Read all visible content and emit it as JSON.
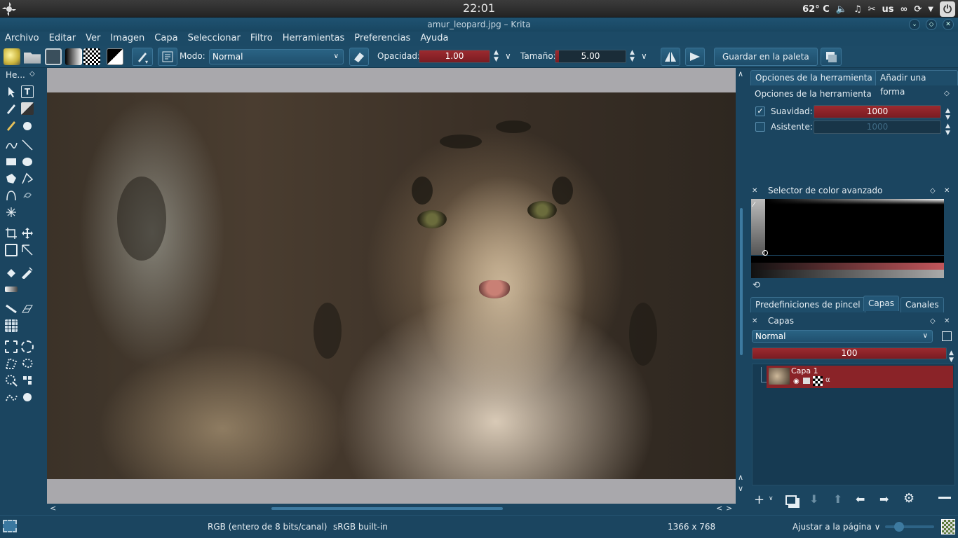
{
  "system": {
    "clock": "22:01",
    "temperature": "62° C",
    "keyboard_layout": "us",
    "icons": [
      "volume-icon",
      "music-icon",
      "scissors-icon",
      "keyboard-icon",
      "link-icon",
      "network-icon",
      "chevron-down-icon",
      "power-icon"
    ]
  },
  "window": {
    "title": "amur_leopard.jpg – Krita"
  },
  "menu": [
    "Archivo",
    "Editar",
    "Ver",
    "Imagen",
    "Capa",
    "Seleccionar",
    "Filtro",
    "Herramientas",
    "Preferencias",
    "Ayuda"
  ],
  "toolbar": {
    "mode_label": "Modo:",
    "mode_value": "Normal",
    "opacity_label": "Opacidad:",
    "opacity_value": "1.00",
    "opacity_fraction": 1.0,
    "size_label": "Tamaño:",
    "size_value": "5.00",
    "size_fraction": 0.05,
    "save_palette_label": "Guardar en la paleta"
  },
  "toolbox": {
    "title": "He..."
  },
  "tool_options": {
    "tab_options": "Opciones de la herramienta",
    "tab_add_shape": "Añadir una forma",
    "panel_title": "Opciones de la herramienta",
    "smoothing_label": "Suavidad:",
    "smoothing_value": "1000",
    "smoothing_checked": true,
    "assistant_label": "Asistente:",
    "assistant_value": "1000",
    "assistant_checked": false
  },
  "color_selector": {
    "title": "Selector de color avanzado"
  },
  "layers": {
    "tab_brush_presets": "Predefiniciones de pincel",
    "tab_layers": "Capas",
    "tab_channels": "Canales",
    "panel_title": "Capas",
    "blend_mode": "Normal",
    "opacity": "100",
    "items": [
      {
        "name": "Capa 1"
      }
    ]
  },
  "statusbar": {
    "color_model": "RGB (entero de 8 bits/canal)",
    "profile": "sRGB built-in",
    "dimensions": "1366 x 768",
    "zoom_mode": "Ajustar a la página"
  },
  "colors": {
    "accent_red": "#8a2328",
    "panel_bg": "#1b4560",
    "canvas_bg": "#a9a8ac"
  }
}
